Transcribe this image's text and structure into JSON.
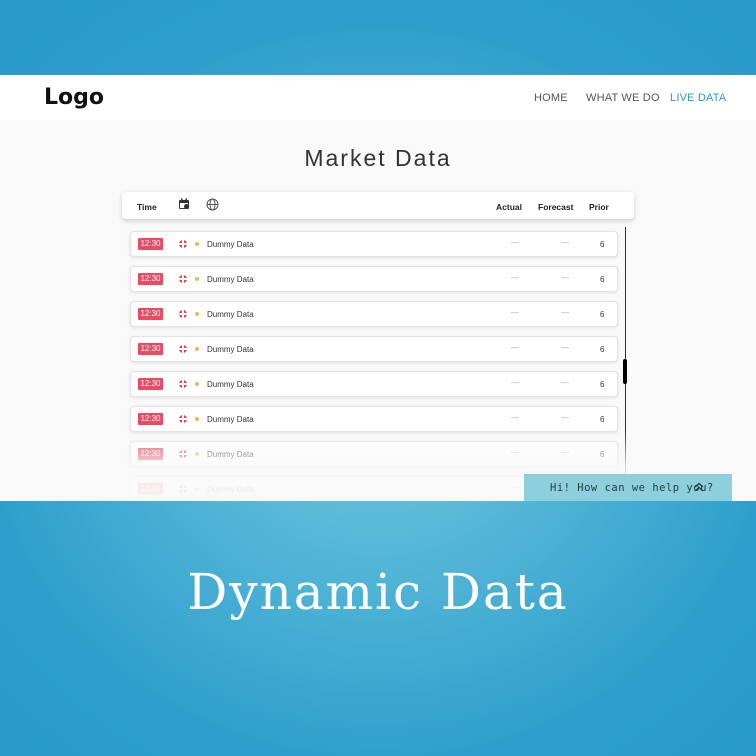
{
  "navbar": {
    "logo": "Logo",
    "links": [
      "HOME",
      "WHAT WE DO",
      "LIVE DATA"
    ],
    "active_link": "LIVE DATA"
  },
  "page": {
    "title": "Market Data"
  },
  "table": {
    "columns": {
      "time": "Time",
      "calendar_icon": "calendar-icon",
      "globe_icon": "globe-icon",
      "actual": "Actual",
      "forecast": "Forecast",
      "prior": "Prior"
    },
    "rows": [
      {
        "time": "12:30",
        "event": "Dummy Data",
        "actual": "—",
        "forecast": "—",
        "prior": "6"
      },
      {
        "time": "12:30",
        "event": "Dummy Data",
        "actual": "—",
        "forecast": "—",
        "prior": "6"
      },
      {
        "time": "12:30",
        "event": "Dummy Data",
        "actual": "—",
        "forecast": "—",
        "prior": "6"
      },
      {
        "time": "12:30",
        "event": "Dummy Data",
        "actual": "—",
        "forecast": "—",
        "prior": "6"
      },
      {
        "time": "12:30",
        "event": "Dummy Data",
        "actual": "—",
        "forecast": "—",
        "prior": "6"
      },
      {
        "time": "12:30",
        "event": "Dummy Data",
        "actual": "—",
        "forecast": "—",
        "prior": "6"
      },
      {
        "time": "12:30",
        "event": "Dummy Data",
        "actual": "—",
        "forecast": "—",
        "prior": "6"
      },
      {
        "time": "12:30",
        "event": "Dummy Data",
        "actual": "—",
        "forecast": "—",
        "prior": "6"
      }
    ]
  },
  "chat": {
    "label": "Hi! How can we help you?",
    "icon": "chevron-up-icon"
  },
  "caption": "Dynamic Data",
  "colors": {
    "background": "#2a9bca",
    "time_badge": "#ec4a63",
    "active_nav": "#2a9bca",
    "chat_widget": "#8ecfdc"
  }
}
